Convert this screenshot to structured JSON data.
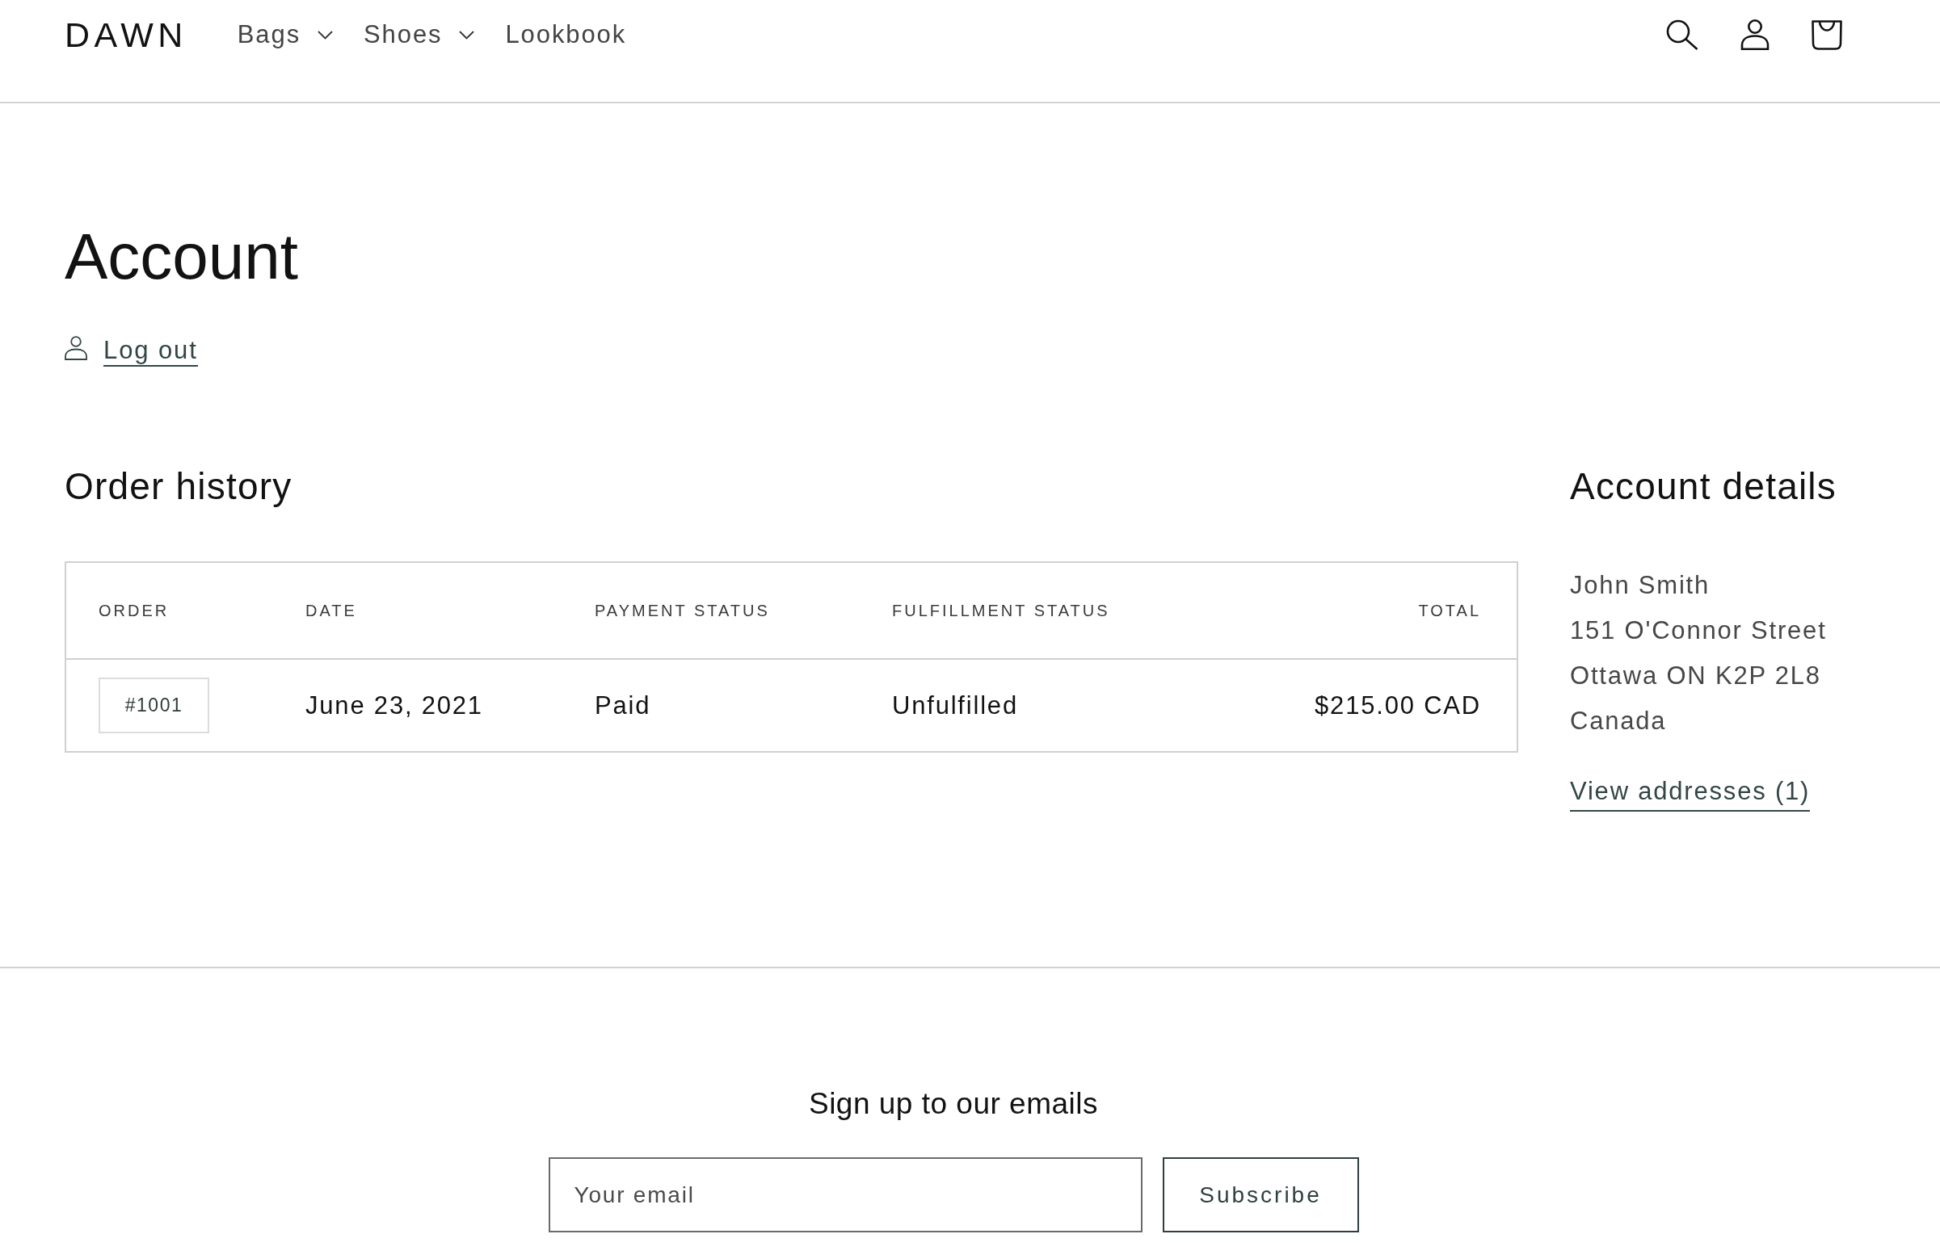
{
  "header": {
    "logo": "DAWN",
    "nav": [
      {
        "label": "Bags",
        "kind": "dropdown"
      },
      {
        "label": "Shoes",
        "kind": "dropdown"
      },
      {
        "label": "Lookbook",
        "kind": "link"
      }
    ]
  },
  "account": {
    "title": "Account",
    "logout_link": "Log out"
  },
  "order_history": {
    "title": "Order history",
    "table": {
      "columns": [
        "ORDER",
        "DATE",
        "PAYMENT STATUS",
        "FULFILLMENT STATUS",
        "TOTAL"
      ],
      "rows": [
        {
          "order": "#1001",
          "date": "June 23, 2021",
          "payment_status": "Paid",
          "fulfillment_status": "Unfulfilled",
          "total": "$215.00 CAD"
        }
      ]
    }
  },
  "account_details": {
    "title": "Account details",
    "address_lines": [
      "John Smith",
      "151 O'Connor Street",
      "Ottawa ON K2P 2L8",
      "Canada"
    ],
    "view_addresses_link": "View addresses (1)"
  },
  "newsletter": {
    "title": "Sign up to our emails",
    "email_field": {
      "placeholder": "Your email"
    },
    "button": "Subscribe"
  }
}
